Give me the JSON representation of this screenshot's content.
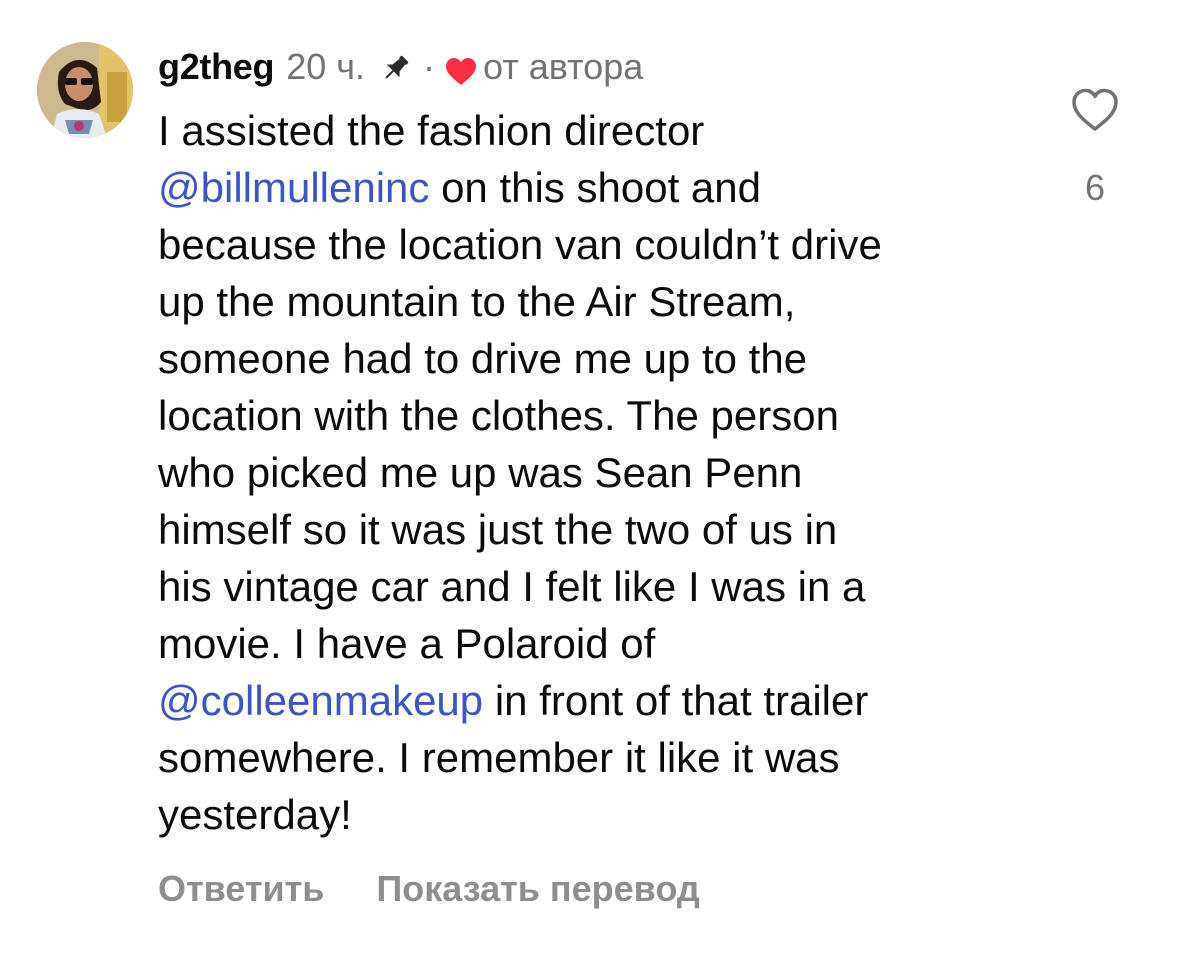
{
  "comment": {
    "username": "g2theg",
    "time": "20 ч.",
    "separator": "·",
    "author_liked_label": "от автора",
    "likes_count": "6",
    "body_segments": [
      [
        {
          "text": "I assisted the fashion director",
          "mention": false
        }
      ],
      [
        {
          "text": "@billmulleninc",
          "mention": true
        },
        {
          "text": " on this shoot and",
          "mention": false
        }
      ],
      [
        {
          "text": "because the location van couldn’t drive",
          "mention": false
        }
      ],
      [
        {
          "text": "up the mountain to the Air Stream,",
          "mention": false
        }
      ],
      [
        {
          "text": "someone had to drive me up to the",
          "mention": false
        }
      ],
      [
        {
          "text": "location with the clothes. The person",
          "mention": false
        }
      ],
      [
        {
          "text": "who picked me up was Sean Penn",
          "mention": false
        }
      ],
      [
        {
          "text": "himself so it was just the two of us in",
          "mention": false
        }
      ],
      [
        {
          "text": "his vintage car and I felt like I was in a",
          "mention": false
        }
      ],
      [
        {
          "text": "movie. I have a Polaroid of",
          "mention": false
        }
      ],
      [
        {
          "text": "@colleenmakeup",
          "mention": true
        },
        {
          "text": " in front of that trailer",
          "mention": false
        }
      ],
      [
        {
          "text": "somewhere. I remember it like it was",
          "mention": false
        }
      ],
      [
        {
          "text": "yesterday!",
          "mention": false
        }
      ]
    ],
    "actions": {
      "reply_label": "Ответить",
      "translate_label": "Показать перевод"
    },
    "icons": {
      "pin": "pin-icon",
      "author_heart": "heart-filled-icon",
      "like": "heart-outline-icon"
    },
    "colors": {
      "mention": "#3b55c8",
      "author_heart": "#ff2d44",
      "meta": "#737373",
      "action": "#8e8e8e"
    }
  }
}
